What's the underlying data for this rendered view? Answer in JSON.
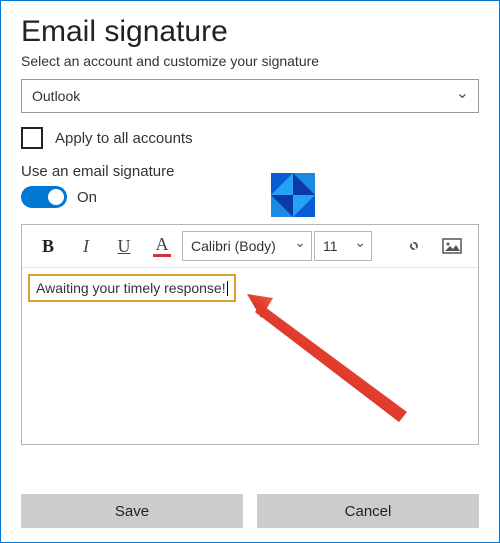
{
  "title": "Email signature",
  "subtitle": "Select an account and customize your signature",
  "account_selected": "Outlook",
  "apply_all_label": "Apply to all accounts",
  "use_sig_label": "Use an email signature",
  "toggle_state": "On",
  "toolbar": {
    "font": "Calibri (Body)",
    "size": "11"
  },
  "signature_text": "Awaiting your timely response!",
  "buttons": {
    "save": "Save",
    "cancel": "Cancel"
  }
}
